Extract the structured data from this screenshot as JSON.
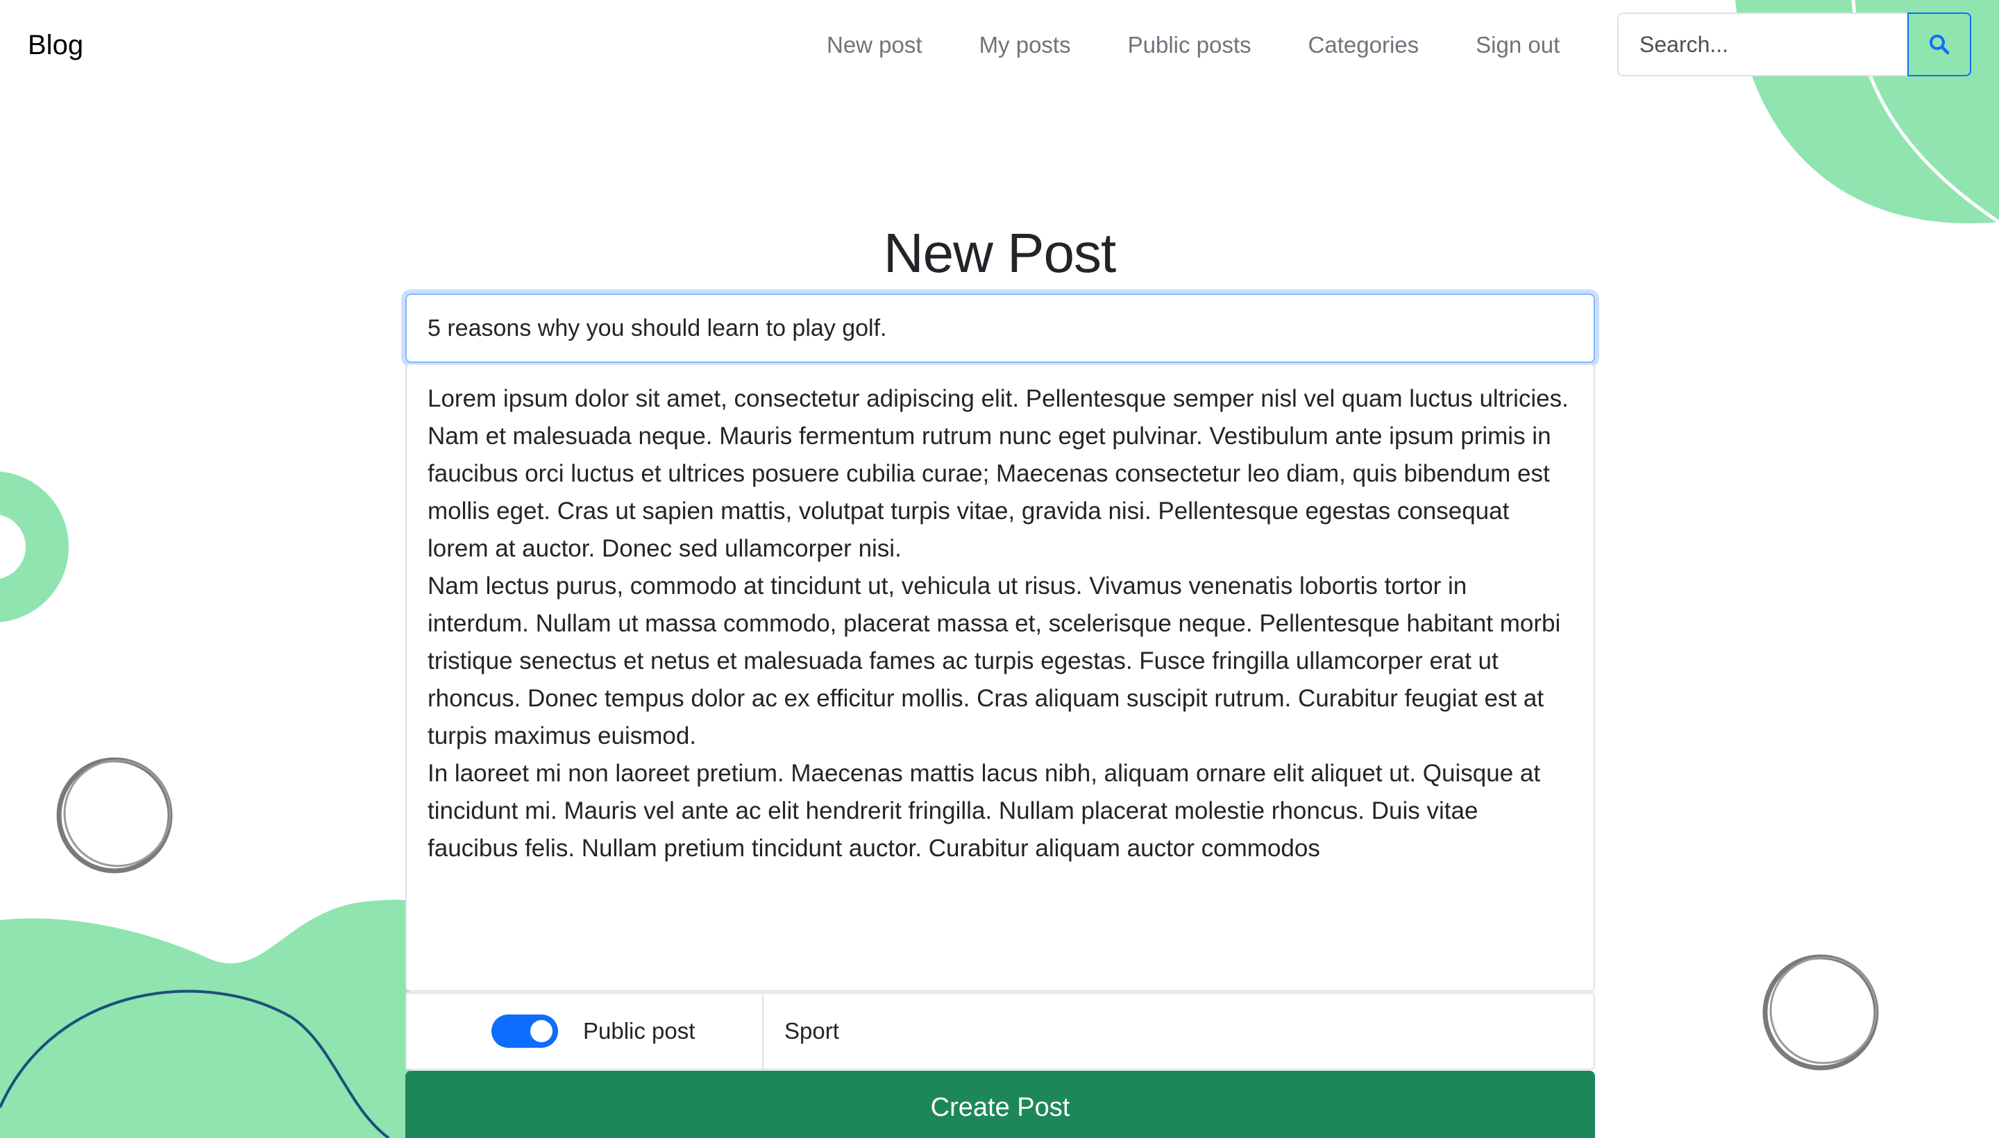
{
  "brand": "Blog",
  "nav": {
    "items": [
      {
        "label": "New post"
      },
      {
        "label": "My posts"
      },
      {
        "label": "Public posts"
      },
      {
        "label": "Categories"
      },
      {
        "label": "Sign out"
      }
    ]
  },
  "search": {
    "placeholder": "Search...",
    "value": "",
    "button_icon": "search-icon"
  },
  "form": {
    "heading": "New Post",
    "title_value": "5 reasons why you should learn to play golf.",
    "body_paragraphs": [
      "Lorem ipsum dolor sit amet, consectetur adipiscing elit. Pellentesque semper nisl vel quam luctus ultricies. Nam et malesuada neque. Mauris fermentum rutrum nunc eget pulvinar. Vestibulum ante ipsum primis in faucibus orci luctus et ultrices posuere cubilia curae; Maecenas consectetur leo diam, quis bibendum est mollis eget. Cras ut sapien mattis, volutpat turpis vitae, gravida nisi. Pellentesque egestas consequat lorem at auctor. Donec sed ullamcorper nisi.",
      "Nam lectus purus, commodo at tincidunt ut, vehicula ut risus. Vivamus venenatis lobortis tortor in interdum. Nullam ut massa commodo, placerat massa et, scelerisque neque. Pellentesque habitant morbi tristique senectus et netus et malesuada fames ac turpis egestas. Fusce fringilla ullamcorper erat ut rhoncus. Donec tempus dolor ac ex efficitur mollis. Cras aliquam suscipit rutrum. Curabitur feugiat est at turpis maximus euismod.",
      "In laoreet mi non laoreet pretium. Maecenas mattis lacus nibh, aliquam ornare elit aliquet ut. Quisque at tincidunt mi. Mauris vel ante ac elit hendrerit fringilla. Nullam placerat molestie rhoncus. Duis vitae faucibus felis. Nullam pretium tincidunt auctor. Curabitur aliquam auctor commodos"
    ],
    "public_label": "Public post",
    "public_checked": true,
    "category_value": "Sport",
    "submit_label": "Create Post"
  },
  "colors": {
    "accent_green": "#1e8759",
    "switch_blue": "#0d6efd",
    "deco_green": "#8fe4b0"
  }
}
